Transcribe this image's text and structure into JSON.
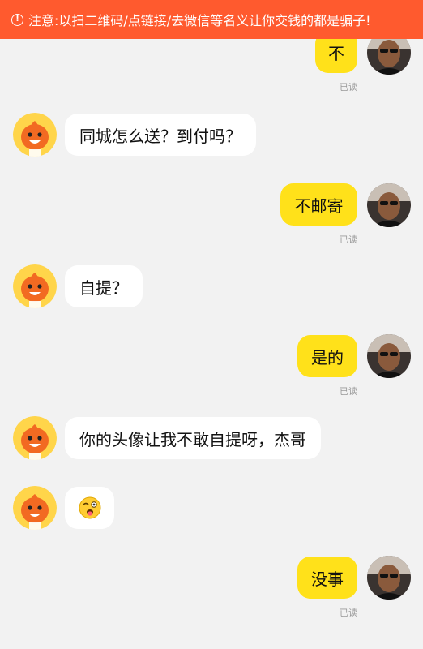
{
  "warning": {
    "icon": "info-icon",
    "text": "注意:以扫二维码/点链接/去微信等名义让你交钱的都是骗子!"
  },
  "messages": [
    {
      "side": "out",
      "text": "不",
      "status": "已读"
    },
    {
      "side": "in",
      "text": "同城怎么送？到付吗？"
    },
    {
      "side": "out",
      "text": "不邮寄",
      "status": "已读"
    },
    {
      "side": "in",
      "text": "自提？"
    },
    {
      "side": "out",
      "text": "是的",
      "status": "已读"
    },
    {
      "side": "in",
      "text": "你的头像让我不敢自提呀，杰哥"
    },
    {
      "side": "in",
      "emoji": "tongue-out-wink-emoji"
    },
    {
      "side": "out",
      "text": "没事",
      "status": "已读"
    }
  ],
  "colors": {
    "warning_bg": "#ff5a2e",
    "out_bubble": "#ffe11a",
    "in_bubble": "#ffffff",
    "background": "#f2f2f2"
  }
}
